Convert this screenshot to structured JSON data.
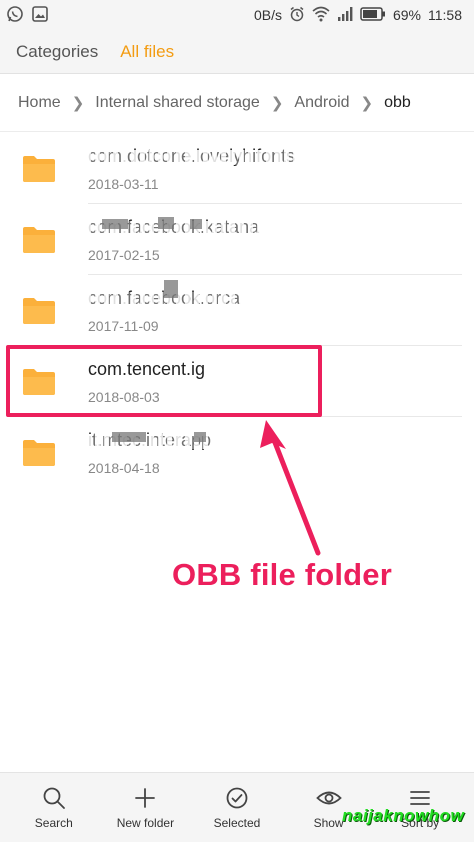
{
  "status_bar": {
    "network_speed": "0B/s",
    "battery": "69%",
    "time": "11:58",
    "icons": [
      "whatsapp-icon",
      "image-icon",
      "alarm-icon",
      "wifi-icon",
      "signal-icon",
      "battery-icon"
    ]
  },
  "tabs": [
    {
      "label": "Categories",
      "active": false
    },
    {
      "label": "All files",
      "active": true
    }
  ],
  "breadcrumb": [
    "Home",
    "Internal shared storage",
    "Android",
    "obb"
  ],
  "files": [
    {
      "name": "com.dotcone.lovelyhifonts",
      "date": "2018-03-11",
      "redacted": true
    },
    {
      "name": "com.facebook.katana",
      "date": "2017-02-15",
      "redacted": true
    },
    {
      "name": "com.facebook.orca",
      "date": "2017-11-09",
      "redacted": true
    },
    {
      "name": "com.tencent.ig",
      "date": "2018-08-03",
      "redacted": false
    },
    {
      "name": "it.mtec.interapp",
      "date": "2018-04-18",
      "redacted": true
    }
  ],
  "annotation": {
    "label": "OBB file folder",
    "color": "#ec1f5c"
  },
  "toolbar": [
    {
      "label": "Search",
      "icon": "search-icon"
    },
    {
      "label": "New folder",
      "icon": "plus-icon"
    },
    {
      "label": "Selected",
      "icon": "check-circle-icon"
    },
    {
      "label": "Show",
      "icon": "eye-icon"
    },
    {
      "label": "Sort by",
      "icon": "menu-icon"
    }
  ],
  "watermark": "naijaknowhow",
  "colors": {
    "accent": "#f39c12",
    "folder": "#fbb03b",
    "highlight": "#ec1f5c"
  }
}
